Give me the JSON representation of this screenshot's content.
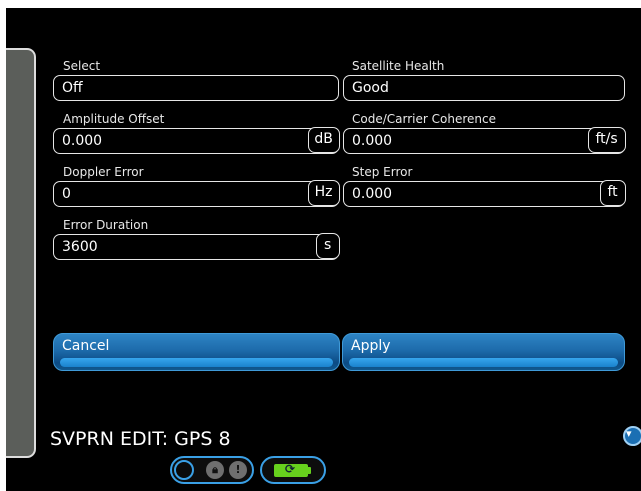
{
  "fields": {
    "select": {
      "label": "Select",
      "value": "Off"
    },
    "satellite_health": {
      "label": "Satellite Health",
      "value": "Good"
    },
    "amplitude_offset": {
      "label": "Amplitude Offset",
      "value": "0.000",
      "unit": "dB"
    },
    "code_carrier": {
      "label": "Code/Carrier Coherence",
      "value": "0.000",
      "unit": "ft/s"
    },
    "doppler_error": {
      "label": "Doppler Error",
      "value": "0",
      "unit": "Hz"
    },
    "step_error": {
      "label": "Step Error",
      "value": "0.000",
      "unit": "ft"
    },
    "error_duration": {
      "label": "Error Duration",
      "value": "3600",
      "unit": "s"
    }
  },
  "buttons": {
    "cancel": "Cancel",
    "apply": "Apply"
  },
  "screen_title": "SVPRN EDIT: GPS 8",
  "icons": {
    "toggle": [
      "circle-toggle-icon",
      "lock-icon",
      "alert-icon"
    ],
    "battery": "battery-charging-icon",
    "scroll": "scroll-down-icon"
  },
  "colors": {
    "accent": "#1d6bab",
    "battery": "#67d11d"
  }
}
